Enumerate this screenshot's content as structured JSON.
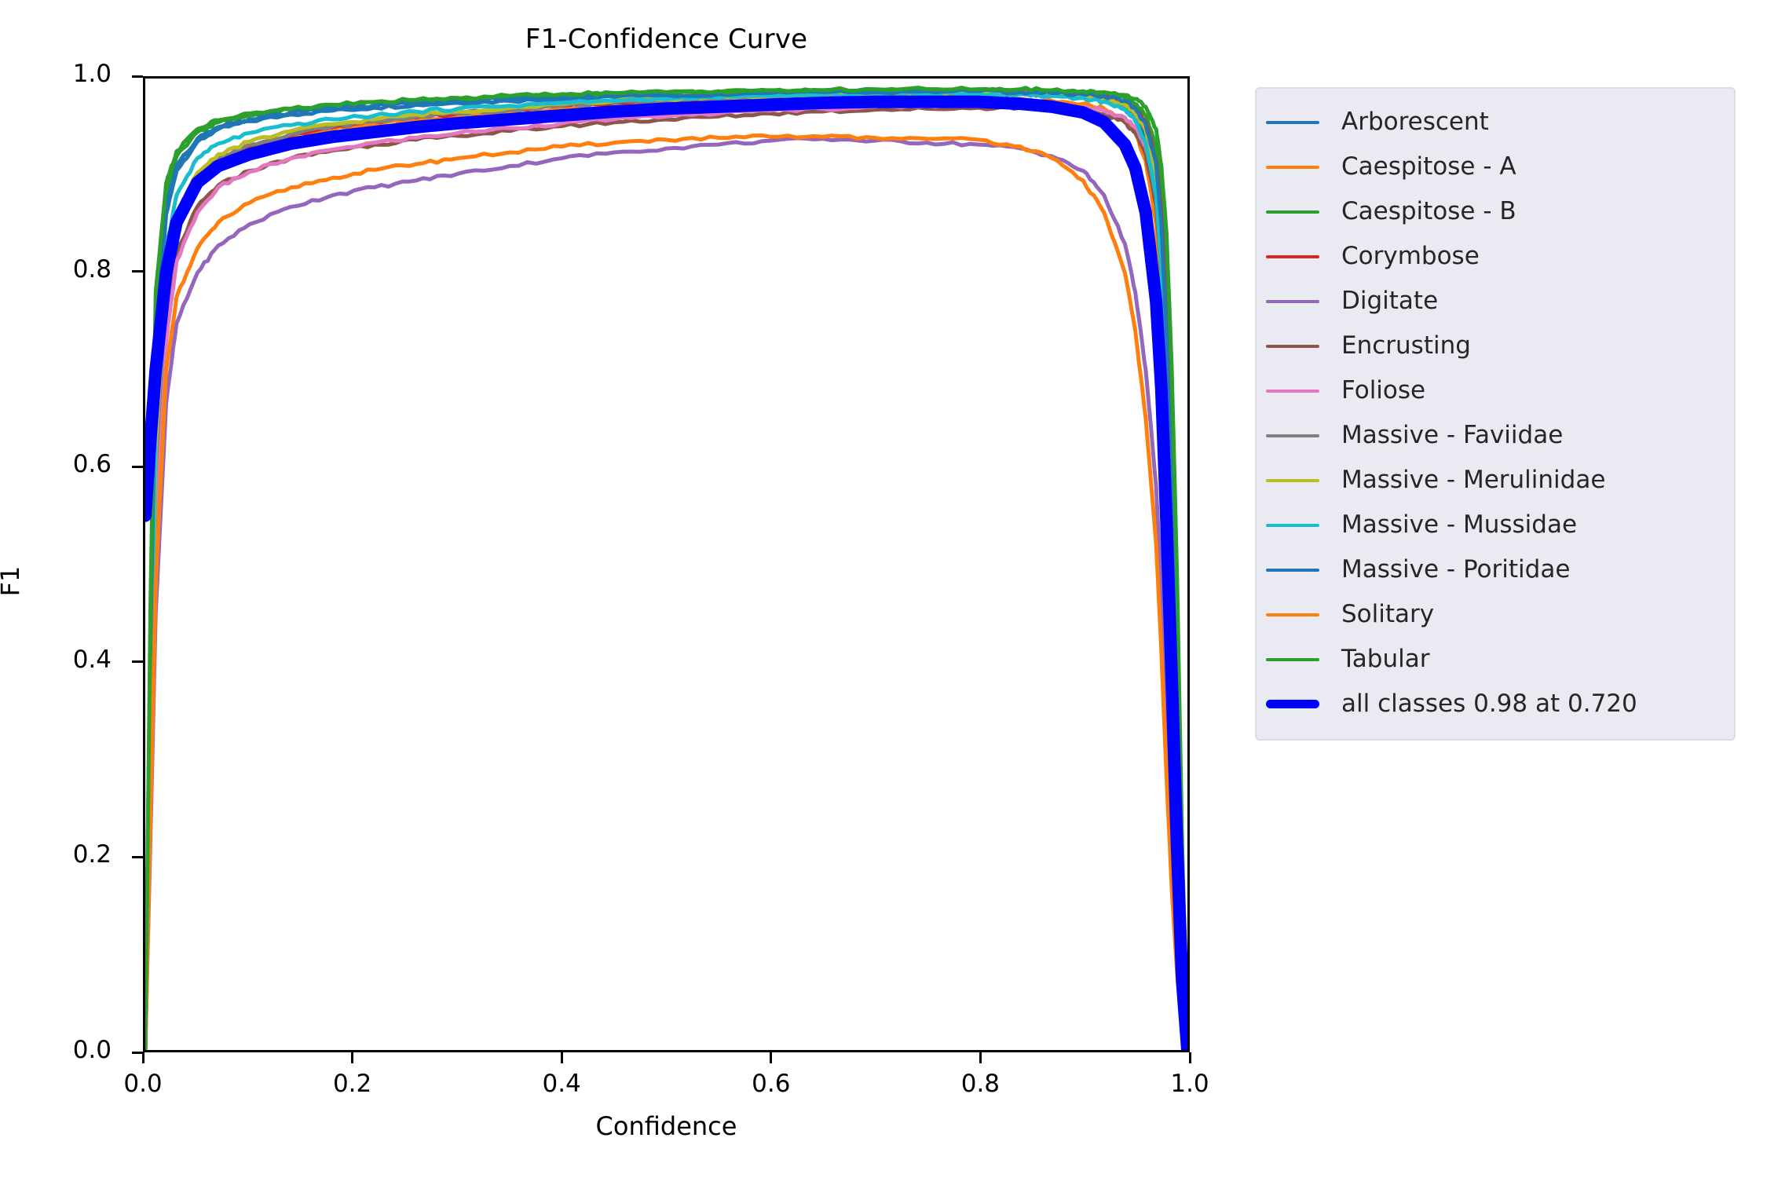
{
  "chart_data": {
    "type": "line",
    "title": "F1-Confidence Curve",
    "xlabel": "Confidence",
    "ylabel": "F1",
    "xlim": [
      0.0,
      1.0
    ],
    "ylim": [
      0.0,
      1.0
    ],
    "xticks": [
      "0.0",
      "0.2",
      "0.4",
      "0.6",
      "0.8",
      "1.0"
    ],
    "yticks": [
      "0.0",
      "0.2",
      "0.4",
      "0.6",
      "0.8",
      "1.0"
    ],
    "xtick_values": [
      0.0,
      0.2,
      0.4,
      0.6,
      0.8,
      1.0
    ],
    "ytick_values": [
      0.0,
      0.2,
      0.4,
      0.6,
      0.8,
      1.0
    ],
    "grid": false,
    "legend_position": "right outside",
    "best_f1": "0.98",
    "best_confidence": "0.720",
    "x": [
      0.0,
      0.005,
      0.01,
      0.02,
      0.03,
      0.05,
      0.07,
      0.1,
      0.14,
      0.18,
      0.22,
      0.26,
      0.3,
      0.35,
      0.4,
      0.45,
      0.5,
      0.55,
      0.6,
      0.65,
      0.7,
      0.75,
      0.8,
      0.84,
      0.87,
      0.9,
      0.92,
      0.94,
      0.95,
      0.96,
      0.97,
      0.975,
      0.98,
      0.985,
      0.99,
      0.995,
      1.0
    ],
    "series": [
      {
        "name": "Arborescent",
        "color": "#1f77b4",
        "values": [
          0.0,
          0.4,
          0.72,
          0.86,
          0.905,
          0.935,
          0.948,
          0.956,
          0.963,
          0.967,
          0.97,
          0.973,
          0.975,
          0.977,
          0.979,
          0.981,
          0.982,
          0.983,
          0.984,
          0.985,
          0.986,
          0.986,
          0.986,
          0.985,
          0.984,
          0.982,
          0.979,
          0.972,
          0.962,
          0.94,
          0.88,
          0.8,
          0.66,
          0.47,
          0.25,
          0.08,
          0.0
        ]
      },
      {
        "name": "Caespitose - A",
        "color": "#ff7f0e",
        "values": [
          0.0,
          0.36,
          0.64,
          0.8,
          0.862,
          0.9,
          0.918,
          0.93,
          0.94,
          0.948,
          0.953,
          0.957,
          0.96,
          0.964,
          0.968,
          0.971,
          0.973,
          0.975,
          0.977,
          0.978,
          0.979,
          0.98,
          0.98,
          0.979,
          0.977,
          0.974,
          0.969,
          0.958,
          0.944,
          0.915,
          0.85,
          0.77,
          0.63,
          0.44,
          0.23,
          0.07,
          0.0
        ]
      },
      {
        "name": "Caespitose - B",
        "color": "#2ca02c",
        "values": [
          0.0,
          0.44,
          0.76,
          0.885,
          0.92,
          0.945,
          0.955,
          0.962,
          0.968,
          0.972,
          0.975,
          0.977,
          0.979,
          0.981,
          0.983,
          0.984,
          0.985,
          0.986,
          0.987,
          0.988,
          0.988,
          0.989,
          0.989,
          0.988,
          0.987,
          0.986,
          0.984,
          0.98,
          0.974,
          0.962,
          0.93,
          0.88,
          0.79,
          0.62,
          0.4,
          0.15,
          0.0
        ]
      },
      {
        "name": "Corymbose",
        "color": "#d62728",
        "values": [
          0.0,
          0.3,
          0.58,
          0.775,
          0.845,
          0.895,
          0.915,
          0.93,
          0.942,
          0.95,
          0.956,
          0.96,
          0.964,
          0.968,
          0.972,
          0.975,
          0.977,
          0.979,
          0.981,
          0.982,
          0.983,
          0.984,
          0.985,
          0.985,
          0.984,
          0.983,
          0.981,
          0.976,
          0.969,
          0.955,
          0.915,
          0.86,
          0.75,
          0.57,
          0.34,
          0.11,
          0.0
        ]
      },
      {
        "name": "Digitate",
        "color": "#9467bd",
        "values": [
          0.0,
          0.22,
          0.45,
          0.665,
          0.748,
          0.8,
          0.828,
          0.85,
          0.868,
          0.88,
          0.888,
          0.895,
          0.902,
          0.91,
          0.918,
          0.924,
          0.928,
          0.932,
          0.936,
          0.938,
          0.936,
          0.934,
          0.932,
          0.928,
          0.92,
          0.905,
          0.88,
          0.83,
          0.78,
          0.7,
          0.58,
          0.47,
          0.33,
          0.2,
          0.1,
          0.03,
          0.0
        ]
      },
      {
        "name": "Encrusting",
        "color": "#8c564b",
        "values": [
          0.0,
          0.28,
          0.55,
          0.745,
          0.82,
          0.868,
          0.89,
          0.905,
          0.918,
          0.926,
          0.932,
          0.937,
          0.941,
          0.946,
          0.951,
          0.955,
          0.958,
          0.961,
          0.964,
          0.966,
          0.968,
          0.969,
          0.97,
          0.97,
          0.969,
          0.967,
          0.963,
          0.955,
          0.944,
          0.922,
          0.87,
          0.8,
          0.68,
          0.5,
          0.28,
          0.09,
          0.0
        ]
      },
      {
        "name": "Foliose",
        "color": "#e377c2",
        "values": [
          0.0,
          0.26,
          0.52,
          0.73,
          0.812,
          0.862,
          0.888,
          0.904,
          0.918,
          0.927,
          0.934,
          0.939,
          0.944,
          0.949,
          0.954,
          0.958,
          0.961,
          0.964,
          0.967,
          0.969,
          0.971,
          0.972,
          0.973,
          0.973,
          0.972,
          0.97,
          0.967,
          0.96,
          0.95,
          0.93,
          0.885,
          0.82,
          0.7,
          0.52,
          0.3,
          0.1,
          0.0
        ]
      },
      {
        "name": "Massive - Faviidae",
        "color": "#7f7f7f",
        "values": [
          0.0,
          0.31,
          0.6,
          0.785,
          0.852,
          0.898,
          0.918,
          0.932,
          0.943,
          0.951,
          0.956,
          0.961,
          0.964,
          0.968,
          0.972,
          0.975,
          0.977,
          0.979,
          0.981,
          0.982,
          0.983,
          0.984,
          0.984,
          0.984,
          0.983,
          0.981,
          0.978,
          0.972,
          0.963,
          0.946,
          0.9,
          0.835,
          0.715,
          0.53,
          0.3,
          0.095,
          0.0
        ]
      },
      {
        "name": "Massive - Merulinidae",
        "color": "#bcbd22",
        "values": [
          0.0,
          0.33,
          0.62,
          0.8,
          0.86,
          0.903,
          0.922,
          0.935,
          0.946,
          0.953,
          0.958,
          0.963,
          0.966,
          0.97,
          0.974,
          0.977,
          0.979,
          0.981,
          0.982,
          0.983,
          0.984,
          0.985,
          0.985,
          0.985,
          0.984,
          0.982,
          0.979,
          0.973,
          0.964,
          0.947,
          0.902,
          0.838,
          0.718,
          0.535,
          0.305,
          0.098,
          0.0
        ]
      },
      {
        "name": "Massive - Mussidae",
        "color": "#17becf",
        "values": [
          0.0,
          0.35,
          0.66,
          0.825,
          0.88,
          0.918,
          0.933,
          0.944,
          0.952,
          0.958,
          0.962,
          0.966,
          0.969,
          0.972,
          0.975,
          0.977,
          0.979,
          0.98,
          0.982,
          0.983,
          0.984,
          0.984,
          0.984,
          0.984,
          0.982,
          0.98,
          0.976,
          0.968,
          0.956,
          0.934,
          0.88,
          0.805,
          0.675,
          0.49,
          0.265,
          0.085,
          0.0
        ]
      },
      {
        "name": "Massive - Poritidae",
        "color": "#1f77b4",
        "values": [
          0.0,
          0.42,
          0.74,
          0.868,
          0.91,
          0.938,
          0.95,
          0.958,
          0.965,
          0.969,
          0.972,
          0.975,
          0.977,
          0.979,
          0.981,
          0.982,
          0.983,
          0.984,
          0.985,
          0.986,
          0.986,
          0.987,
          0.987,
          0.986,
          0.985,
          0.984,
          0.982,
          0.977,
          0.969,
          0.953,
          0.912,
          0.85,
          0.735,
          0.555,
          0.325,
          0.105,
          0.0
        ]
      },
      {
        "name": "Solitary",
        "color": "#ff7f0e",
        "values": [
          0.0,
          0.24,
          0.48,
          0.7,
          0.775,
          0.825,
          0.852,
          0.872,
          0.888,
          0.898,
          0.906,
          0.912,
          0.918,
          0.924,
          0.93,
          0.934,
          0.937,
          0.939,
          0.94,
          0.94,
          0.939,
          0.938,
          0.937,
          0.93,
          0.918,
          0.895,
          0.862,
          0.8,
          0.74,
          0.65,
          0.52,
          0.41,
          0.28,
          0.165,
          0.08,
          0.025,
          0.0
        ]
      },
      {
        "name": "Tabular",
        "color": "#2ca02c",
        "values": [
          0.0,
          0.46,
          0.78,
          0.892,
          0.925,
          0.948,
          0.957,
          0.964,
          0.969,
          0.973,
          0.976,
          0.978,
          0.98,
          0.982,
          0.984,
          0.985,
          0.986,
          0.987,
          0.988,
          0.988,
          0.989,
          0.989,
          0.989,
          0.989,
          0.988,
          0.987,
          0.986,
          0.983,
          0.979,
          0.971,
          0.948,
          0.91,
          0.84,
          0.7,
          0.49,
          0.21,
          0.0
        ]
      },
      {
        "name": "all classes 0.98 at 0.720",
        "color": "#0000ff",
        "bold": true,
        "values": [
          0.55,
          0.63,
          0.7,
          0.8,
          0.852,
          0.893,
          0.91,
          0.922,
          0.933,
          0.94,
          0.945,
          0.95,
          0.954,
          0.958,
          0.962,
          0.966,
          0.969,
          0.971,
          0.973,
          0.975,
          0.976,
          0.976,
          0.976,
          0.974,
          0.971,
          0.965,
          0.955,
          0.932,
          0.908,
          0.862,
          0.77,
          0.68,
          0.54,
          0.38,
          0.21,
          0.07,
          0.0
        ]
      }
    ]
  },
  "legend": {
    "entries": [
      {
        "label": "Arborescent",
        "color": "#1f77b4",
        "bold": false
      },
      {
        "label": "Caespitose - A",
        "color": "#ff7f0e",
        "bold": false
      },
      {
        "label": "Caespitose - B",
        "color": "#2ca02c",
        "bold": false
      },
      {
        "label": "Corymbose",
        "color": "#d62728",
        "bold": false
      },
      {
        "label": "Digitate",
        "color": "#9467bd",
        "bold": false
      },
      {
        "label": "Encrusting",
        "color": "#8c564b",
        "bold": false
      },
      {
        "label": "Foliose",
        "color": "#e377c2",
        "bold": false
      },
      {
        "label": "Massive - Faviidae",
        "color": "#7f7f7f",
        "bold": false
      },
      {
        "label": "Massive - Merulinidae",
        "color": "#bcbd22",
        "bold": false
      },
      {
        "label": "Massive - Mussidae",
        "color": "#17becf",
        "bold": false
      },
      {
        "label": "Massive - Poritidae",
        "color": "#1f77b4",
        "bold": false
      },
      {
        "label": "Solitary",
        "color": "#ff7f0e",
        "bold": false
      },
      {
        "label": "Tabular",
        "color": "#2ca02c",
        "bold": false
      },
      {
        "label": "all classes 0.98 at 0.720",
        "color": "#0000ff",
        "bold": true
      }
    ],
    "background": "#eaeaf2",
    "border": "#dcdce4"
  }
}
